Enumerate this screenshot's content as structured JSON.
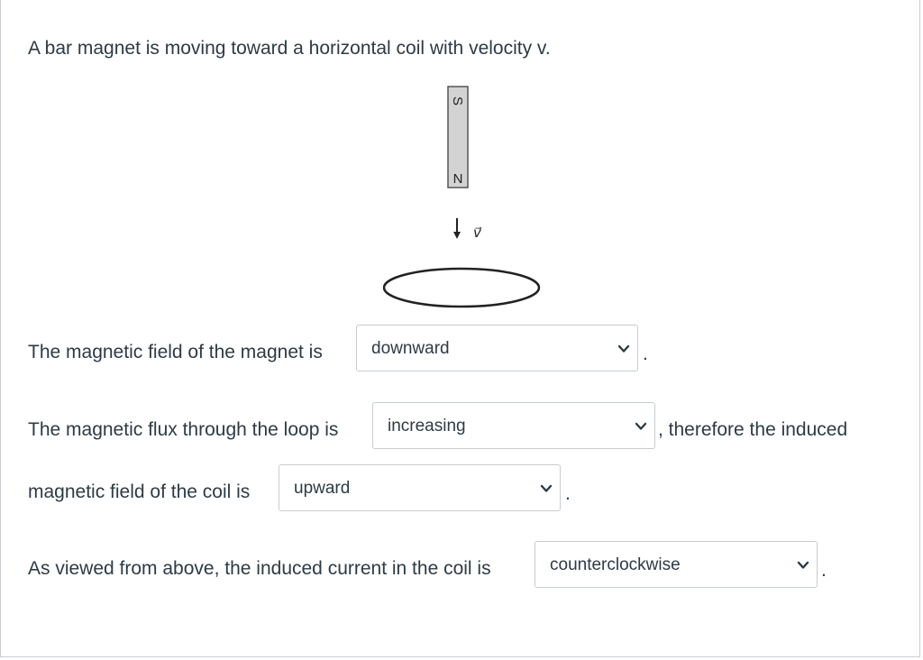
{
  "question": {
    "intro": "A bar magnet is moving toward a horizontal coil with velocity v."
  },
  "figure": {
    "magnet_top_label": "S",
    "magnet_bottom_label": "N",
    "velocity_label": "v⃗"
  },
  "q1": {
    "prefix": "The magnetic field of the magnet is",
    "selected": "downward",
    "suffix": "."
  },
  "q2": {
    "prefix": "The magnetic flux through the loop is",
    "selected": "increasing",
    "suffix": ", therefore the induced"
  },
  "q3": {
    "prefix": "magnetic field of the coil is",
    "selected": "upward",
    "suffix": "."
  },
  "q4": {
    "prefix": "As viewed from above, the induced current in the coil is",
    "selected": "counterclockwise",
    "suffix": "."
  }
}
